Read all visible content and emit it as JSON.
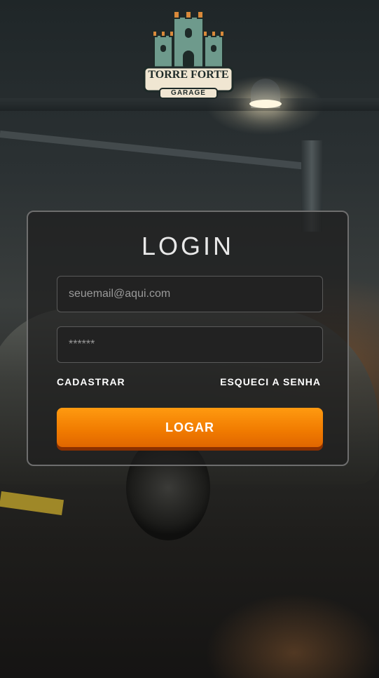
{
  "brand": {
    "logo_name": "TORRE FORTE",
    "logo_subtitle": "GARAGE",
    "accent_color": "#f07a00"
  },
  "login": {
    "title": "LOGIN",
    "email_placeholder": "seuemail@aqui.com",
    "password_placeholder": "******",
    "register_label": "CADASTRAR",
    "forgot_label": "ESQUECI A SENHA",
    "submit_label": "LOGAR"
  }
}
